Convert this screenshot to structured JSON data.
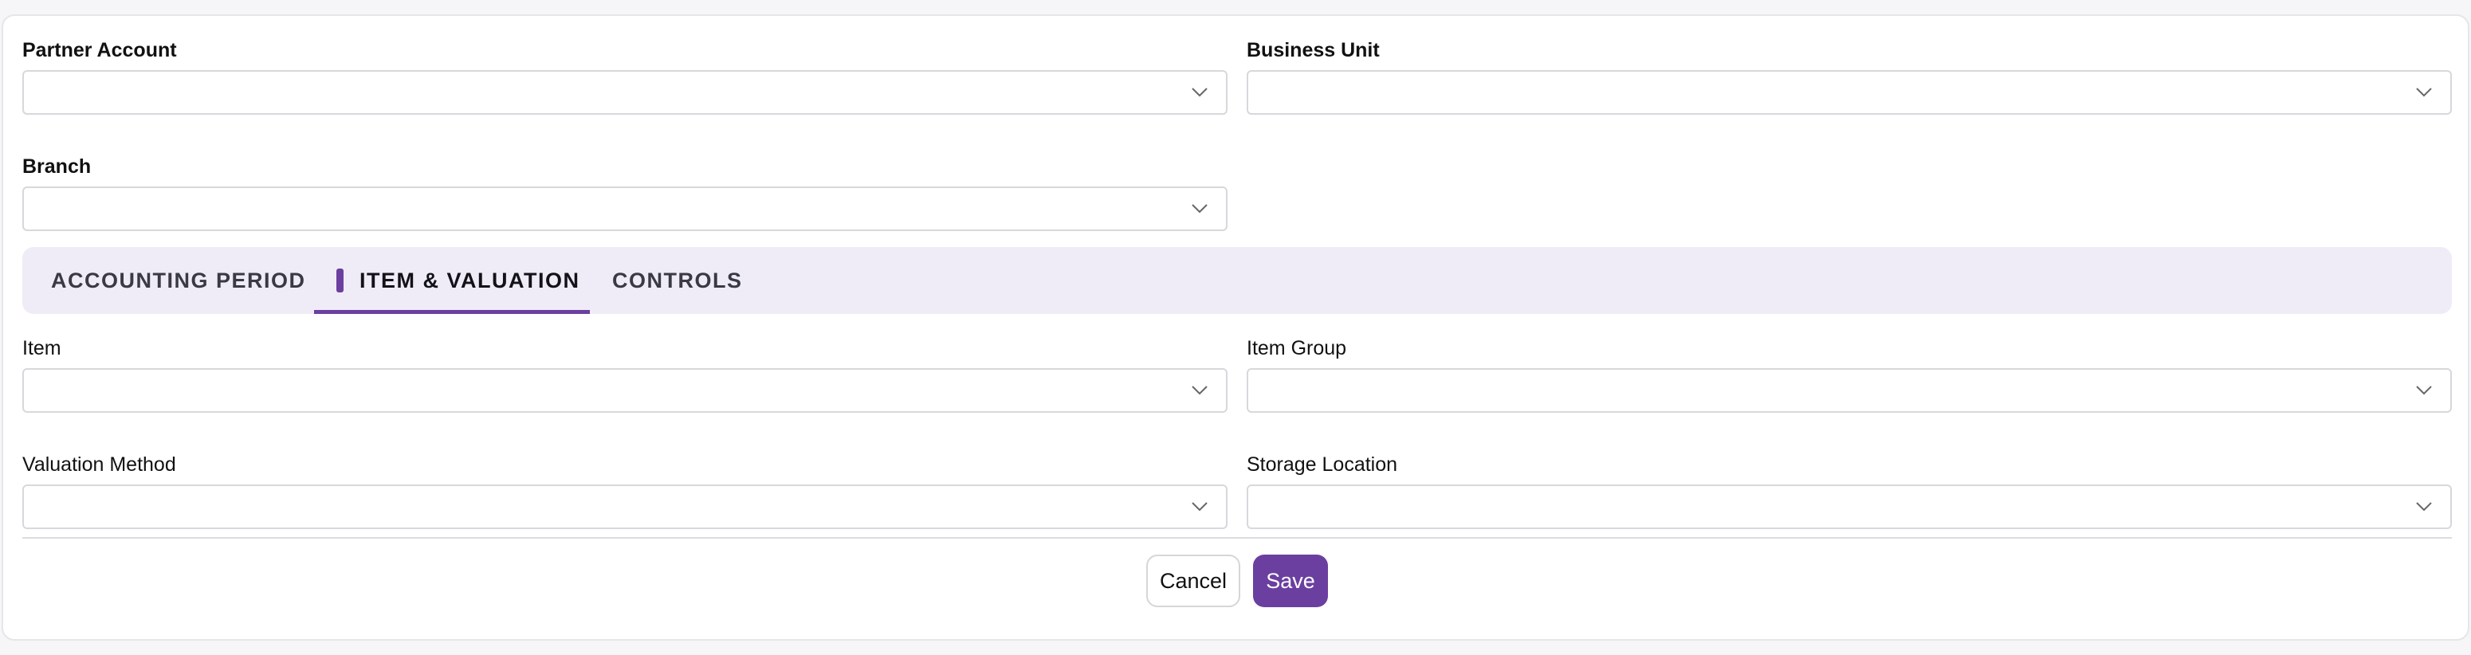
{
  "header_fields": {
    "partner_account": {
      "label": "Partner Account",
      "value": ""
    },
    "business_unit": {
      "label": "Business Unit",
      "value": ""
    },
    "branch": {
      "label": "Branch",
      "value": ""
    }
  },
  "tabs": [
    {
      "label": "ACCOUNTING PERIOD",
      "active": false
    },
    {
      "label": "ITEM & VALUATION",
      "active": true
    },
    {
      "label": "CONTROLS",
      "active": false
    }
  ],
  "tab_fields": {
    "item": {
      "label": "Item",
      "value": ""
    },
    "item_group": {
      "label": "Item Group",
      "value": ""
    },
    "valuation_method": {
      "label": "Valuation Method",
      "value": ""
    },
    "storage_location": {
      "label": "Storage Location",
      "value": ""
    }
  },
  "actions": {
    "cancel_label": "Cancel",
    "save_label": "Save"
  },
  "colors": {
    "accent": "#6b3fa0",
    "tabbar_bg": "#efecf7"
  },
  "icons": {
    "select_chevron": "chevron-down-icon"
  }
}
